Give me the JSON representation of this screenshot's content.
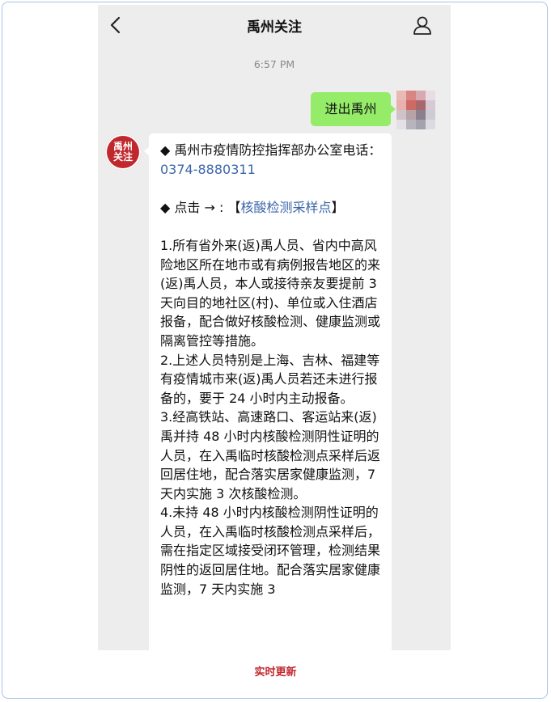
{
  "header": {
    "title": "禹州关注",
    "back_icon": "chevron-left-icon",
    "profile_icon": "person-icon"
  },
  "chat": {
    "timestamp": "6:57 PM",
    "sent_message": "进出禹州",
    "official_account_avatar_text": "禹州关注",
    "received": {
      "office_line_prefix": "◆ 禹州市疫情防控指挥部办公室电话：",
      "office_phone": "0374-8880311",
      "click_prefix": "◆ 点击 → : ",
      "click_link_open": "【",
      "click_link_text": "核酸检测采样点",
      "click_link_close": "】",
      "para1": "1.所有省外来(返)禹人员、省内中高风险地区所在地市或有病例报告地区的来(返)禹人员，本人或接待亲友要提前 3 天向目的地社区(村)、单位或入住酒店报备，配合做好核酸检测、健康监测或隔离管控等措施。",
      "para2": "2.上述人员特别是上海、吉林、福建等有疫情城市来(返)禹人员若还未进行报备的，要于 24 小时内主动报备。",
      "para3": "3.经高铁站、高速路口、客运站来(返)禹并持 48 小时内核酸检测阴性证明的人员，在入禹临时核酸检测点采样后返回居住地，配合落实居家健康监测，7 天内实施 3 次核酸检测。",
      "para4": "4.未持 48 小时内核酸检测阴性证明的人员，在入禹临时核酸检测点采样后，需在指定区域接受闭环管理，检测结果阴性的返回居住地。配合落实居家健康监测，7 天内实施 3"
    }
  },
  "footer": {
    "label": "实时更新"
  },
  "colors": {
    "sent_bubble": "#95ec69",
    "chat_background": "#ededed",
    "link": "#3b66a8",
    "brand_red": "#c0282e"
  }
}
